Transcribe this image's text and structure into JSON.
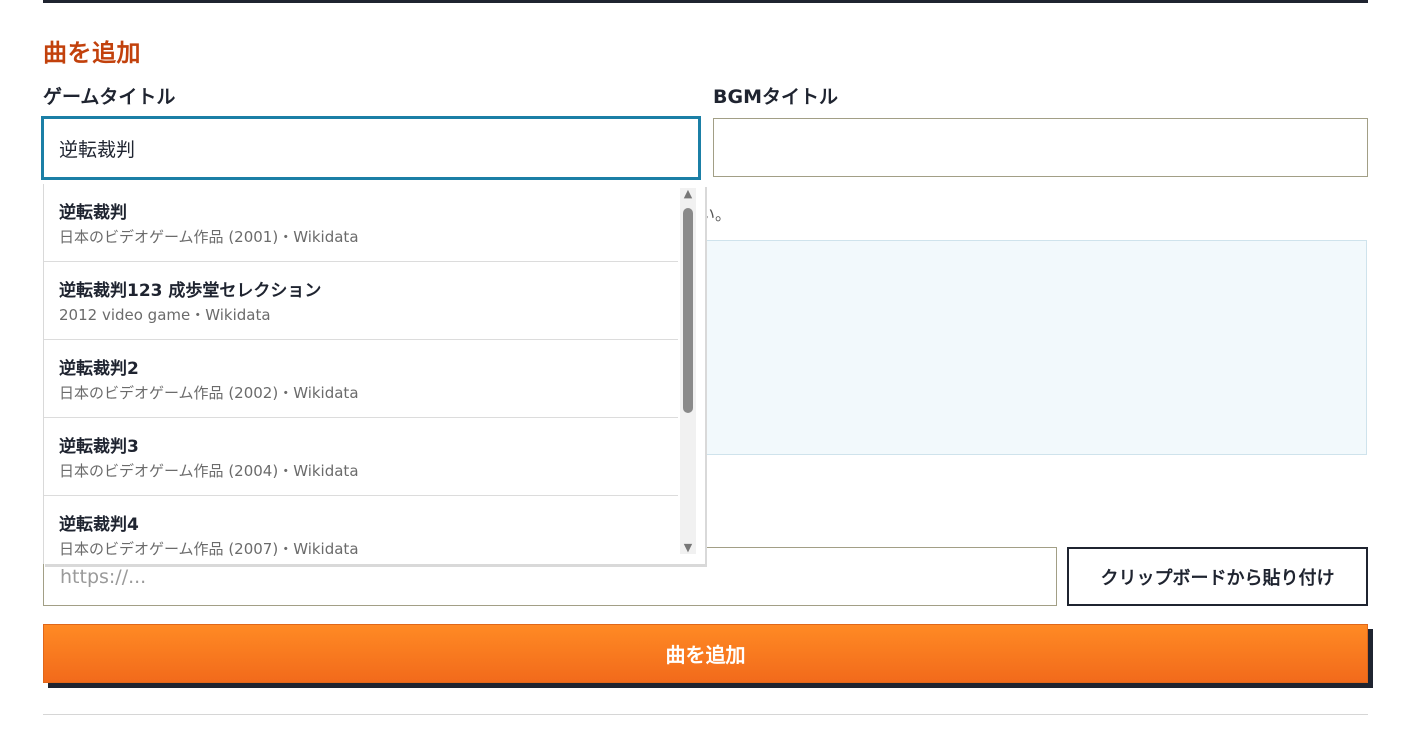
{
  "section_title": "曲を追加",
  "form": {
    "game_title_label": "ゲームタイトル",
    "game_title_value": "逆転裁判",
    "bgm_title_label": "BGMタイトル",
    "bgm_title_value": "",
    "hint_fragment": "い。",
    "url_placeholder": "https://...",
    "paste_button_label": "クリップボードから貼り付け",
    "submit_label": "曲を追加"
  },
  "suggestions": [
    {
      "title": "逆転裁判",
      "description": "日本のビデオゲーム作品 (2001)・Wikidata"
    },
    {
      "title": "逆転裁判123 成歩堂セレクション",
      "description": "2012 video game・Wikidata"
    },
    {
      "title": "逆転裁判2",
      "description": "日本のビデオゲーム作品 (2002)・Wikidata"
    },
    {
      "title": "逆転裁判3",
      "description": "日本のビデオゲーム作品 (2004)・Wikidata"
    },
    {
      "title": "逆転裁判4",
      "description": "日本のビデオゲーム作品 (2007)・Wikidata"
    }
  ],
  "icons": {
    "scroll_up": "triangle-up-icon",
    "scroll_down": "triangle-down-icon"
  },
  "colors": {
    "accent_heading": "#c2410c",
    "submit_orange": "#f97316",
    "focus_border": "#1b7fa6"
  }
}
